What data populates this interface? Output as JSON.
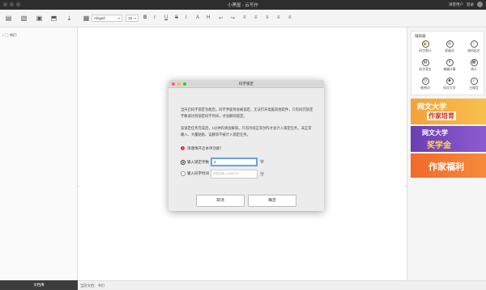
{
  "window": {
    "title": "小黑屋 - 云写作",
    "right_text_1": "演客用户",
    "right_text_2": "登录"
  },
  "toolbar": {
    "font_family": "Abigail",
    "font_size": "18",
    "icons": [
      "new-book-icon",
      "import-icon",
      "export-icon",
      "backup-icon",
      "download-icon",
      "view-icon"
    ],
    "format_icons": [
      "B",
      "I",
      "U",
      "S",
      "I",
      "A",
      "H",
      "↩",
      "↪",
      "≡",
      "≡",
      "≡",
      "≡",
      "≡"
    ]
  },
  "sidebar": {
    "book_label": "书们",
    "bottom_button": "文档库"
  },
  "statusbar": {
    "text": "当前文档：书们"
  },
  "right_panel": {
    "tools_title": "辅助器",
    "tools": [
      {
        "icon": "lock-icon",
        "glyph": "🔒",
        "label": "码字倒计"
      },
      {
        "icon": "target-icon",
        "glyph": "◎",
        "label": "屏蔽词"
      },
      {
        "icon": "bubble-icon",
        "glyph": "○",
        "label": "随机起名"
      },
      {
        "icon": "bag-icon",
        "glyph": "▤",
        "label": "码字背包"
      },
      {
        "icon": "coin-icon",
        "glyph": "¥",
        "label": "稿酬计算"
      },
      {
        "icon": "grid-icon",
        "glyph": "▦",
        "label": "统计"
      },
      {
        "icon": "clock-icon",
        "glyph": "◷",
        "label": "敏感词"
      },
      {
        "icon": "people-icon",
        "glyph": "☻",
        "label": "网文大学"
      },
      {
        "icon": "music-icon",
        "glyph": "♫",
        "label": "白噪音"
      }
    ],
    "banners": [
      {
        "line1": "网文大学",
        "line2": "作家培育"
      },
      {
        "line1": "网文大学",
        "line2": "奖学金"
      },
      {
        "line1": "作家福利"
      }
    ]
  },
  "dialog": {
    "title": "码字锁定",
    "para1": "当开启码字锁定功能后，码字界面将会被锁定。无法打开电脑其他软件，只有码完锁定字数或达到锁定码字时间，才会解除锁定。",
    "para2": "该锁定任务完成后，1分钟内将会解锁。只有持续正常创作才会计入锁定任务，非正常输入、大量粘贴、误删等不被计入锁定任务。",
    "warning": "请谨慎开启本项功能！",
    "option1_label": "输入锁定字数",
    "option1_value": "4",
    "option1_unit": "字",
    "option2_label": "输入码字时间",
    "option2_placeholder": "请直接输入持续时长",
    "option2_unit": "分",
    "cancel": "取消",
    "confirm": "确定"
  }
}
